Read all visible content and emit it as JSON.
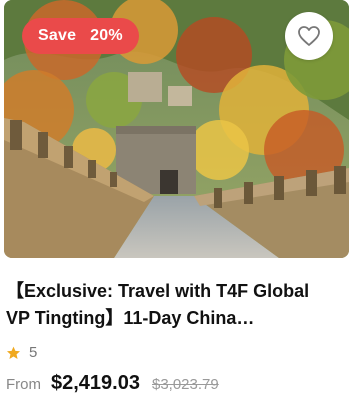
{
  "badge": {
    "save_label": "Save",
    "discount": "20%"
  },
  "favorite": {
    "icon": "heart-outline-icon"
  },
  "product": {
    "title_line1": "【Exclusive: Travel with T4F Global",
    "title_line2": "VP Tingting】11-Day China…",
    "rating": "5",
    "from_label": "From",
    "price": "$2,419.03",
    "original_price": "$3,023.79"
  },
  "colors": {
    "badge_bg": "#ea4a4a",
    "star": "#f0a91f",
    "text": "#111111"
  }
}
